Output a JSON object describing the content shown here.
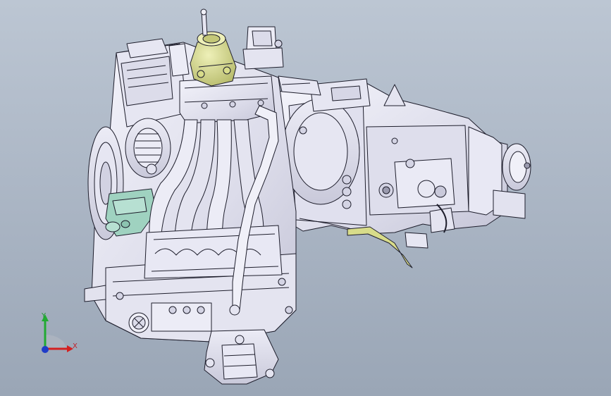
{
  "viewport": {
    "background_top": "#bcc6d3",
    "background_bottom": "#9aa6b6"
  },
  "model": {
    "body_color": "#e8e8f3",
    "edge_color": "#1e1e2c",
    "accent_yellow": "#d8dc8a",
    "accent_green": "#9fd2c0"
  },
  "triad": {
    "x_label": "X",
    "y_label": "Y",
    "x_color": "#d42020",
    "y_color": "#22aa33",
    "z_color": "#1f3cc8"
  }
}
